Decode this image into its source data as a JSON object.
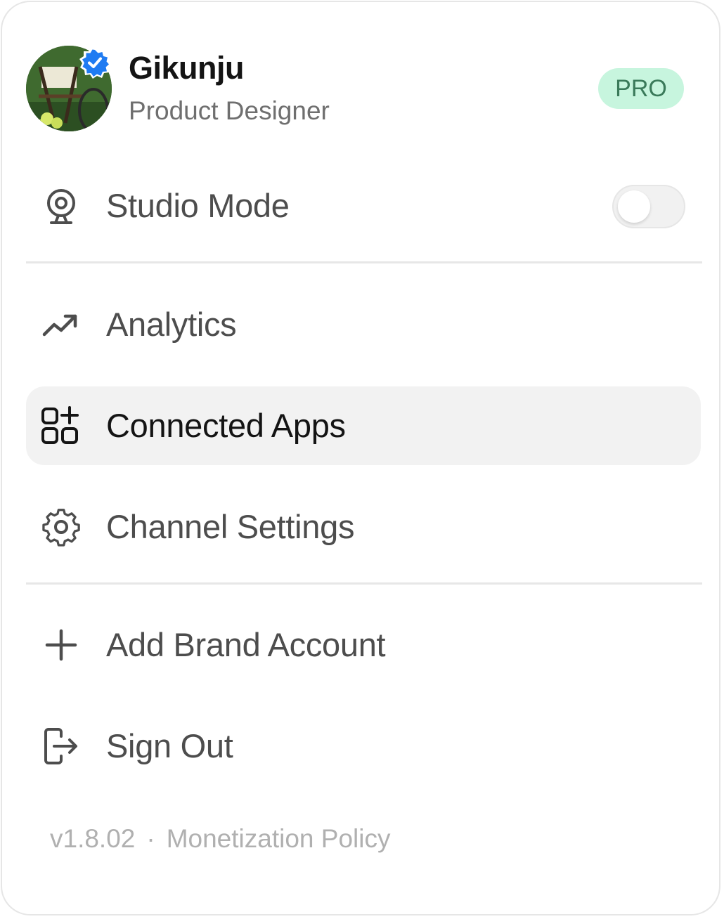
{
  "profile": {
    "name": "Gikunju",
    "role": "Product Designer",
    "badge": "PRO",
    "verified_icon": "verified-check-icon"
  },
  "menu": {
    "studio_mode": {
      "label": "Studio Mode",
      "icon": "webcam-icon",
      "toggle_on": false
    },
    "items": [
      {
        "label": "Analytics",
        "icon": "trending-up-icon"
      },
      {
        "label": "Connected Apps",
        "icon": "apps-add-icon",
        "active": true
      },
      {
        "label": "Channel Settings",
        "icon": "gear-icon"
      },
      {
        "label": "Add Brand Account",
        "icon": "plus-icon"
      },
      {
        "label": "Sign Out",
        "icon": "sign-out-icon"
      }
    ]
  },
  "footer": {
    "version": "v1.8.02",
    "separator": "·",
    "policy_link": "Monetization Policy"
  }
}
